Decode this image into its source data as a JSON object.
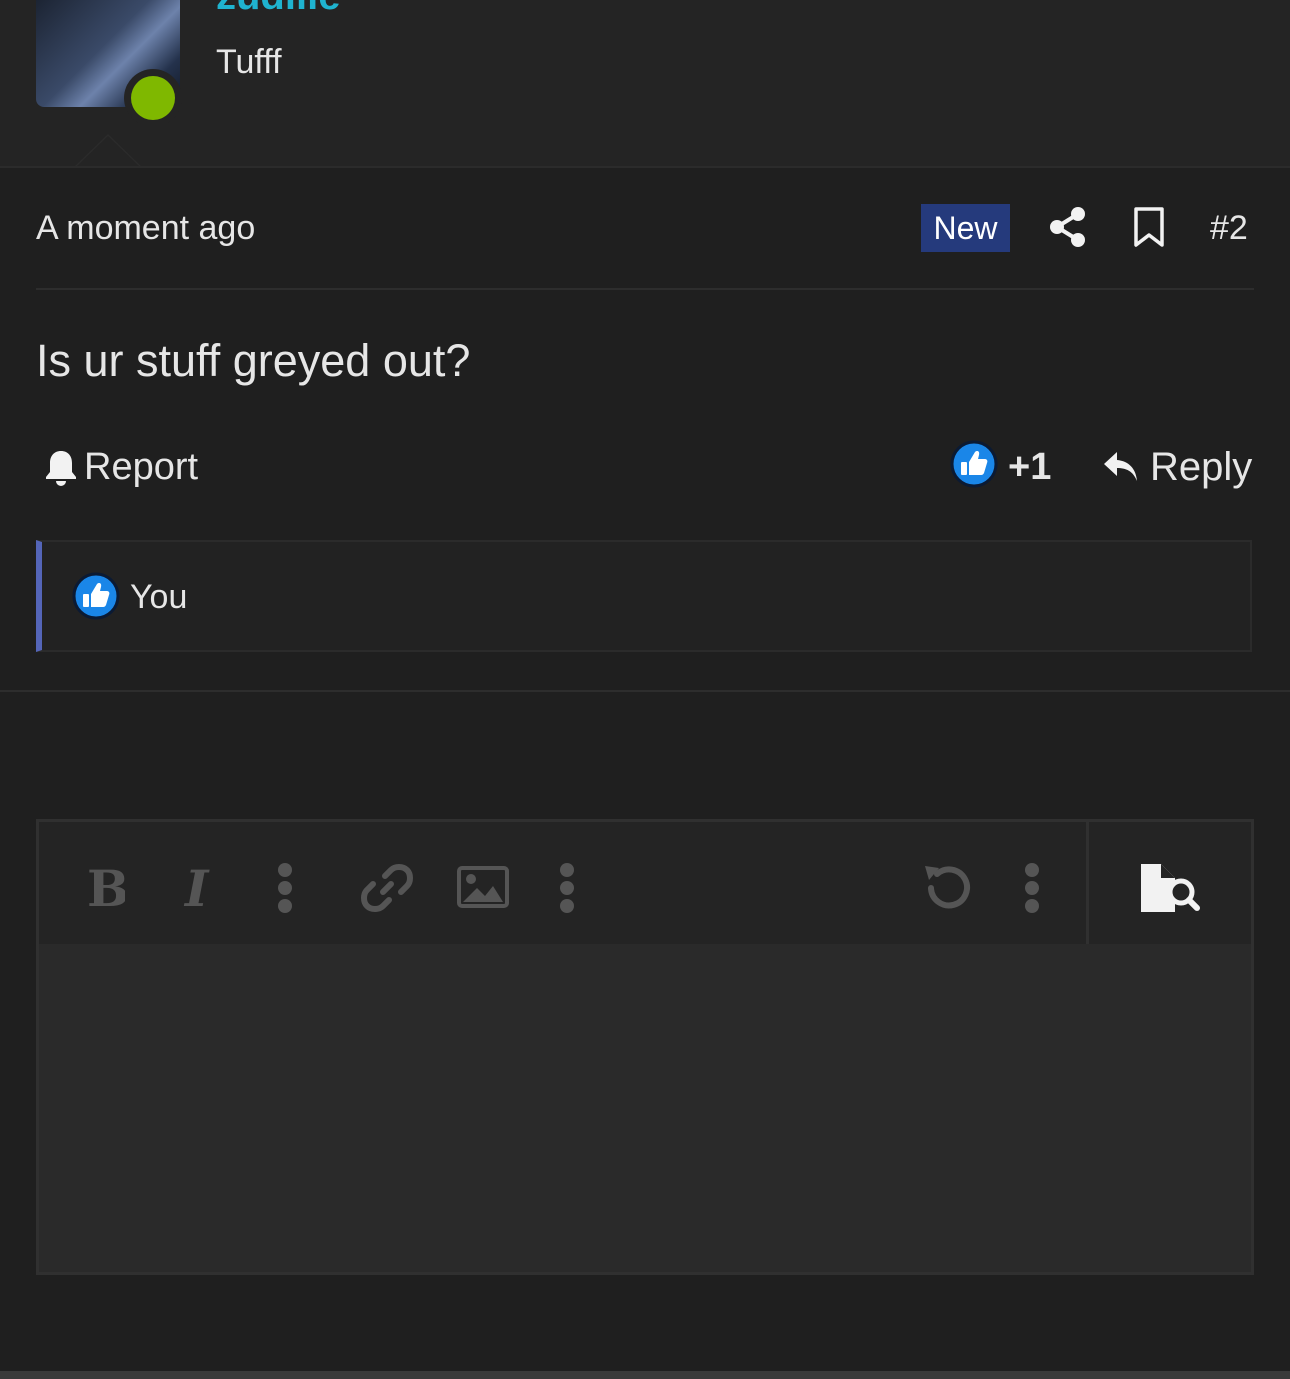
{
  "user": {
    "username": "zudiiie",
    "title": "Tufff",
    "online_color": "#7fb800"
  },
  "post": {
    "timestamp": "A moment ago",
    "new_badge": "New",
    "number": "#2",
    "body": "Is ur stuff greyed out?",
    "report_label": "Report",
    "reaction_count": "+1",
    "reply_label": "Reply",
    "reactions": [
      {
        "icon": "like-icon",
        "name": "You"
      }
    ]
  },
  "editor": {
    "toolbar": [
      "bold-icon",
      "italic-icon",
      "more-vertical-icon",
      "link-icon",
      "image-icon",
      "more-vertical-icon",
      "undo-icon",
      "more-vertical-icon",
      "preview-icon"
    ]
  },
  "colors": {
    "accent_username": "#1fb3cf",
    "badge_bg": "#253a7c",
    "reaction_border": "#5465b8",
    "like_blue": "#1a86e8"
  }
}
